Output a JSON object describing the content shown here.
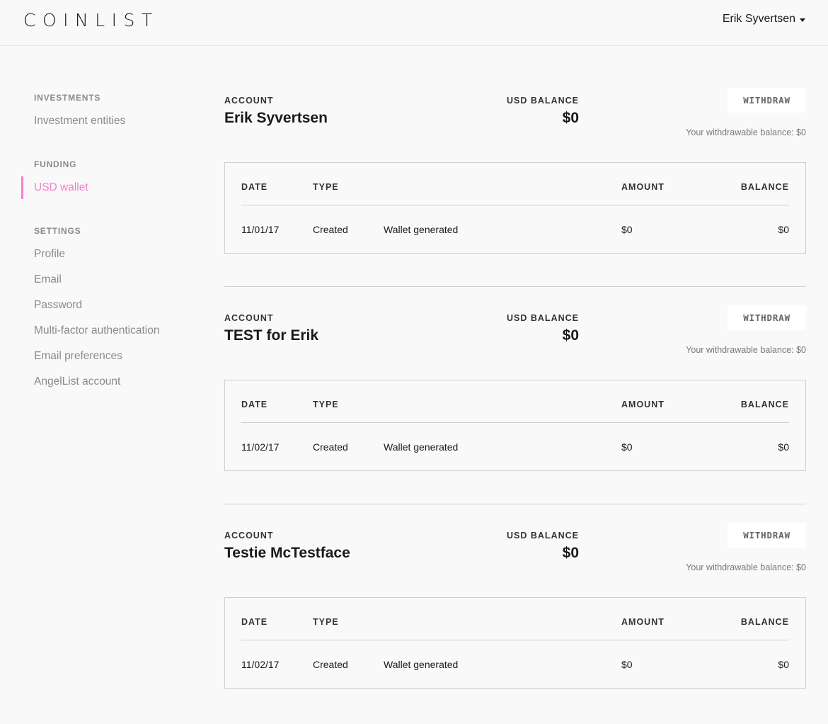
{
  "header": {
    "logo": "COINLIST",
    "user_name": "Erik Syvertsen"
  },
  "sidebar": {
    "sections": [
      {
        "title": "INVESTMENTS",
        "items": [
          "Investment entities"
        ]
      },
      {
        "title": "FUNDING",
        "items": [
          "USD wallet"
        ]
      },
      {
        "title": "SETTINGS",
        "items": [
          "Profile",
          "Email",
          "Password",
          "Multi-factor authentication",
          "Email preferences",
          "AngelList account"
        ]
      }
    ],
    "active_item": "USD wallet"
  },
  "labels": {
    "account": "ACCOUNT",
    "usd_balance": "USD BALANCE",
    "withdraw": "WITHDRAW",
    "col_date": "DATE",
    "col_type": "TYPE",
    "col_amount": "AMOUNT",
    "col_balance": "BALANCE"
  },
  "accounts": [
    {
      "name": "Erik Syvertsen",
      "balance": "$0",
      "withdrawable_note": "Your withdrawable balance: $0",
      "transactions": [
        {
          "date": "11/01/17",
          "type": "Created",
          "description": "Wallet generated",
          "amount": "$0",
          "balance": "$0"
        }
      ]
    },
    {
      "name": "TEST for Erik",
      "balance": "$0",
      "withdrawable_note": "Your withdrawable balance: $0",
      "transactions": [
        {
          "date": "11/02/17",
          "type": "Created",
          "description": "Wallet generated",
          "amount": "$0",
          "balance": "$0"
        }
      ]
    },
    {
      "name": "Testie McTestface",
      "balance": "$0",
      "withdrawable_note": "Your withdrawable balance: $0",
      "transactions": [
        {
          "date": "11/02/17",
          "type": "Created",
          "description": "Wallet generated",
          "amount": "$0",
          "balance": "$0"
        }
      ]
    }
  ],
  "colors": {
    "accent": "#f57fd0",
    "background": "#f9f9f9",
    "muted_text": "#8a8a8a"
  }
}
